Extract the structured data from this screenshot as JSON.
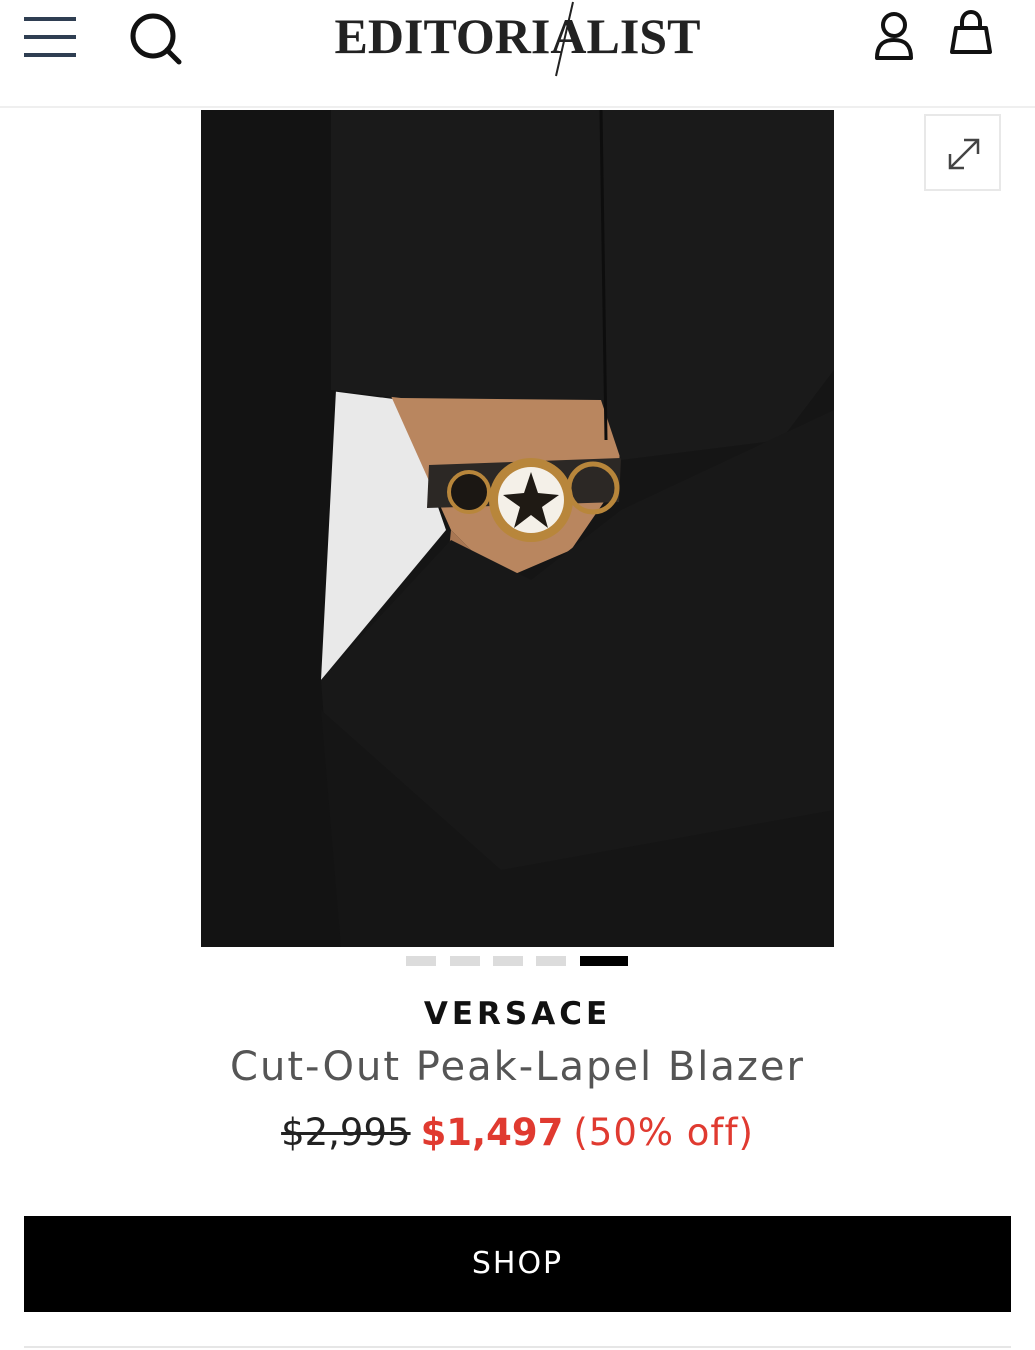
{
  "header": {
    "logo": "EDITORIALIST",
    "icons": {
      "menu": "hamburger-menu-icon",
      "search": "search-icon",
      "account": "user-account-icon",
      "bag": "shopping-bag-icon"
    }
  },
  "gallery": {
    "slide_count": 5,
    "active_index": 4,
    "zoom_icon": "expand-icon",
    "image_description_colors": {
      "garment": "#141414",
      "background": "#f2f2f2",
      "skin": "#b9865f",
      "metal": "#b8863b"
    }
  },
  "product": {
    "brand": "VERSACE",
    "name": "Cut-Out Peak-Lapel Blazer",
    "original_price": "$2,995",
    "sale_price": "$1,497",
    "discount": "(50% off)"
  },
  "actions": {
    "shop_label": "SHOP"
  },
  "colors": {
    "sale_red": "#e03a30",
    "button_black": "#000000",
    "dot_inactive": "#dcdcdc",
    "dot_active": "#000000"
  }
}
